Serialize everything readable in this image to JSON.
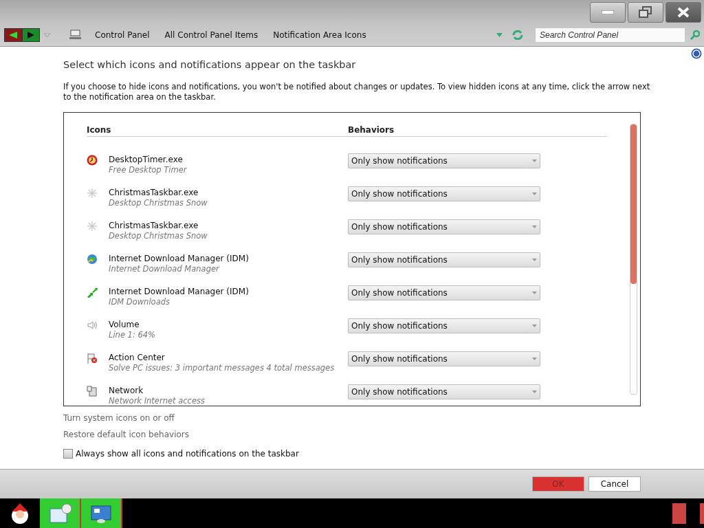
{
  "breadcrumb": [
    "Control Panel",
    "All Control Panel Items",
    "Notification Area Icons"
  ],
  "search": {
    "placeholder": "Search Control Panel"
  },
  "heading": "Select which icons and notifications appear on the taskbar",
  "intro": "If you choose to hide icons and notifications, you won't be notified about changes or updates. To view hidden icons at any time, click the arrow next to the notification area on the taskbar.",
  "table": {
    "columns": [
      "Icons",
      "Behaviors"
    ],
    "rows": [
      {
        "kind": "timer",
        "name": "DesktopTimer.exe",
        "description": "Free Desktop Timer",
        "behavior": "Only show notifications"
      },
      {
        "kind": "snowflake",
        "name": "ChristmasTaskbar.exe",
        "description": "Desktop Christmas Snow",
        "behavior": "Only show notifications"
      },
      {
        "kind": "snowflake",
        "name": "ChristmasTaskbar.exe",
        "description": "Desktop Christmas Snow",
        "behavior": "Only show notifications"
      },
      {
        "kind": "globe",
        "name": "Internet Download Manager (IDM)",
        "description": "Internet Download Manager",
        "behavior": "Only show notifications"
      },
      {
        "kind": "arrows",
        "name": "Internet Download Manager (IDM)",
        "description": "IDM Downloads",
        "behavior": "Only show notifications"
      },
      {
        "kind": "speaker",
        "name": "Volume",
        "description": "Line 1: 64%",
        "behavior": "Only show notifications"
      },
      {
        "kind": "flag",
        "name": "Action Center",
        "description": "Solve PC issues: 3 important messages  4 total messages",
        "behavior": "Only show notifications"
      },
      {
        "kind": "network",
        "name": "Network",
        "description": "Network Internet access",
        "behavior": "Only show notifications"
      }
    ]
  },
  "links": [
    "Turn system icons on or off",
    "Restore default icon behaviors"
  ],
  "always_show": {
    "label": "Always show all icons and notifications on the taskbar",
    "checked": false
  },
  "buttons": [
    "OK",
    "Cancel"
  ]
}
